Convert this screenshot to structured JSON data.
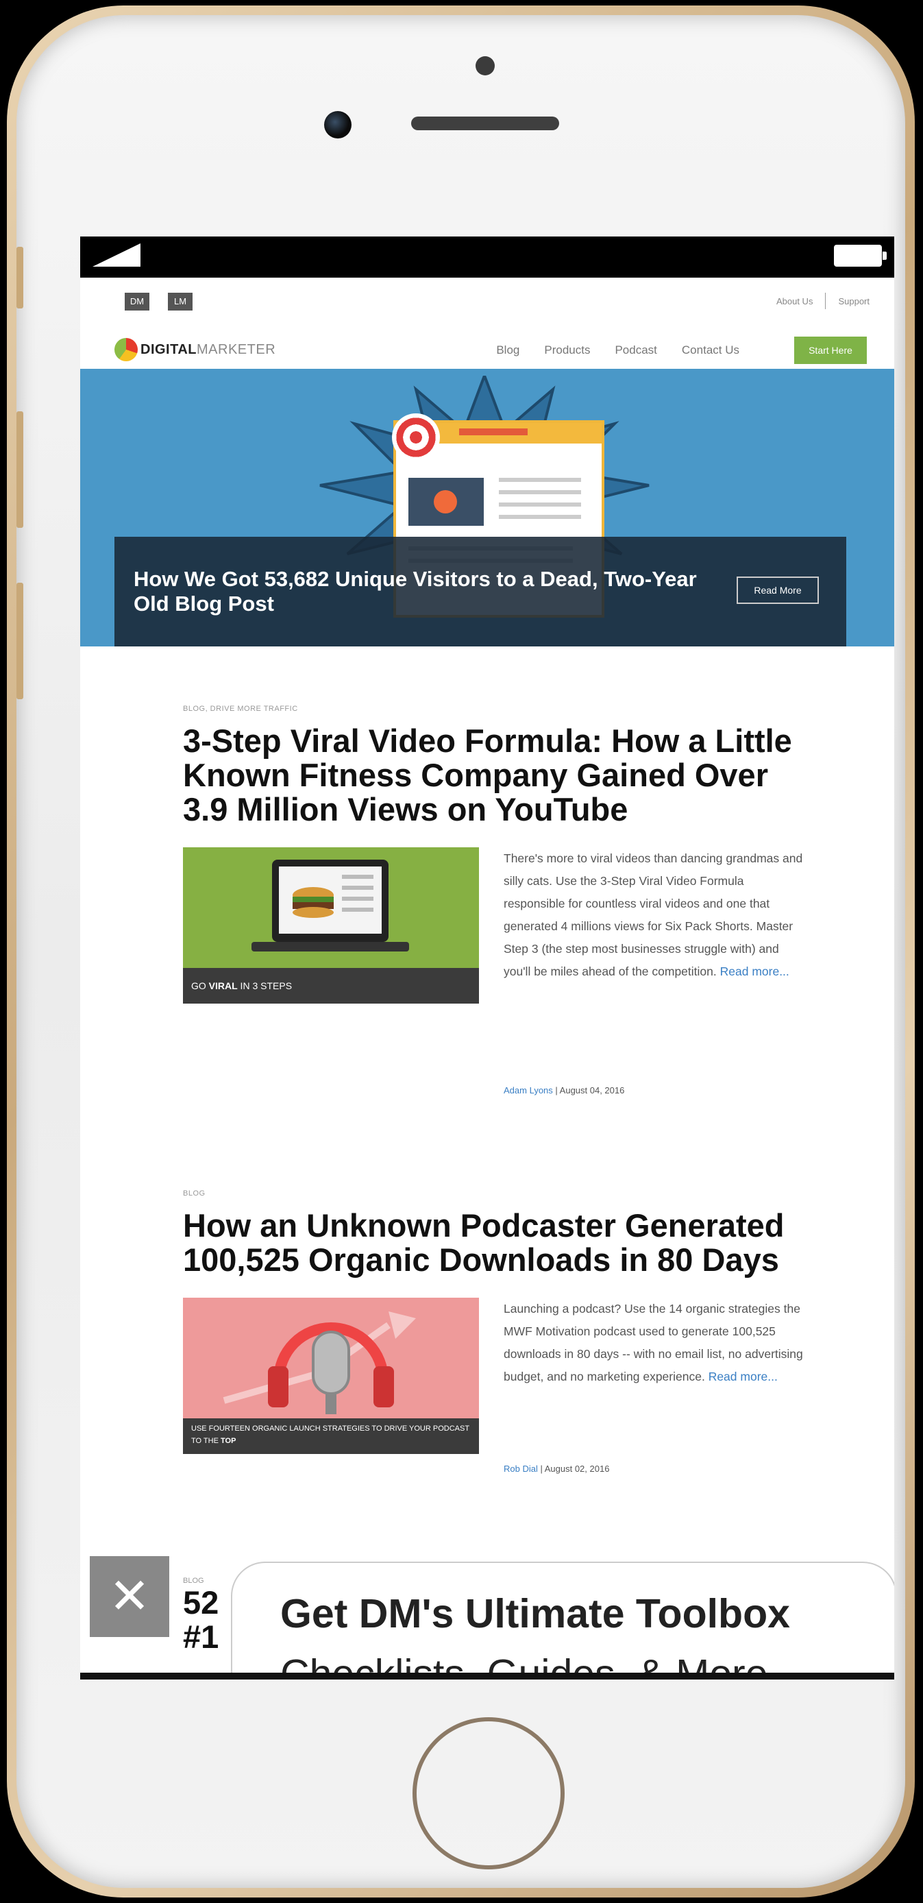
{
  "topbar": {
    "icons": [
      "DM",
      "LM"
    ],
    "links": [
      "About Us",
      "Support"
    ]
  },
  "nav": {
    "logo_bold": "DIGITAL",
    "logo_light": "MARKETER",
    "items": [
      "Blog",
      "Products",
      "Podcast",
      "Contact Us"
    ],
    "cta": "Start Here"
  },
  "hero": {
    "title": "How We Got 53,682 Unique Visitors to a Dead, Two-Year Old Blog Post",
    "read_more": "Read More"
  },
  "articles": [
    {
      "category": "BLOG, DRIVE MORE TRAFFIC",
      "title": "3-Step Viral Video Formula: How a Little Known Fitness Company Gained Over 3.9 Million Views on YouTube",
      "thumb_caption_pre": "GO ",
      "thumb_caption_bold": "VIRAL",
      "thumb_caption_post": " IN 3 STEPS",
      "excerpt": "There's more to viral videos than dancing grandmas and silly cats. Use the 3-Step Viral Video Formula responsible for countless viral videos and one that generated 4 millions views for Six Pack Shorts. Master Step 3 (the step most businesses struggle with) and you'll be miles ahead of the competition.",
      "read_more": "Read more...",
      "author": "Adam Lyons",
      "date": " | August 04, 2016"
    },
    {
      "category": "BLOG",
      "title": "How an Unknown Podcaster Generated 100,525 Organic Downloads in 80 Days",
      "thumb_caption_pre": "USE FOURTEEN ORGANIC LAUNCH STRATEGIES TO DRIVE YOUR PODCAST TO THE ",
      "thumb_caption_bold": "TOP",
      "thumb_caption_post": "",
      "excerpt": "Launching a podcast? Use the 14 organic strategies the MWF Motivation podcast used to generate 100,525 downloads in 80 days -- with no email list, no advertising budget, and no marketing experience.",
      "read_more": "Read more...",
      "author": "Rob Dial",
      "date": " | August 02, 2016"
    }
  ],
  "partial": {
    "category": "BLOG",
    "line1": "52",
    "line2": "#1"
  },
  "optin": {
    "close": "✕",
    "title": "Get DM's Ultimate Toolbox",
    "subtitle": "Checklists, Guides, & More"
  }
}
